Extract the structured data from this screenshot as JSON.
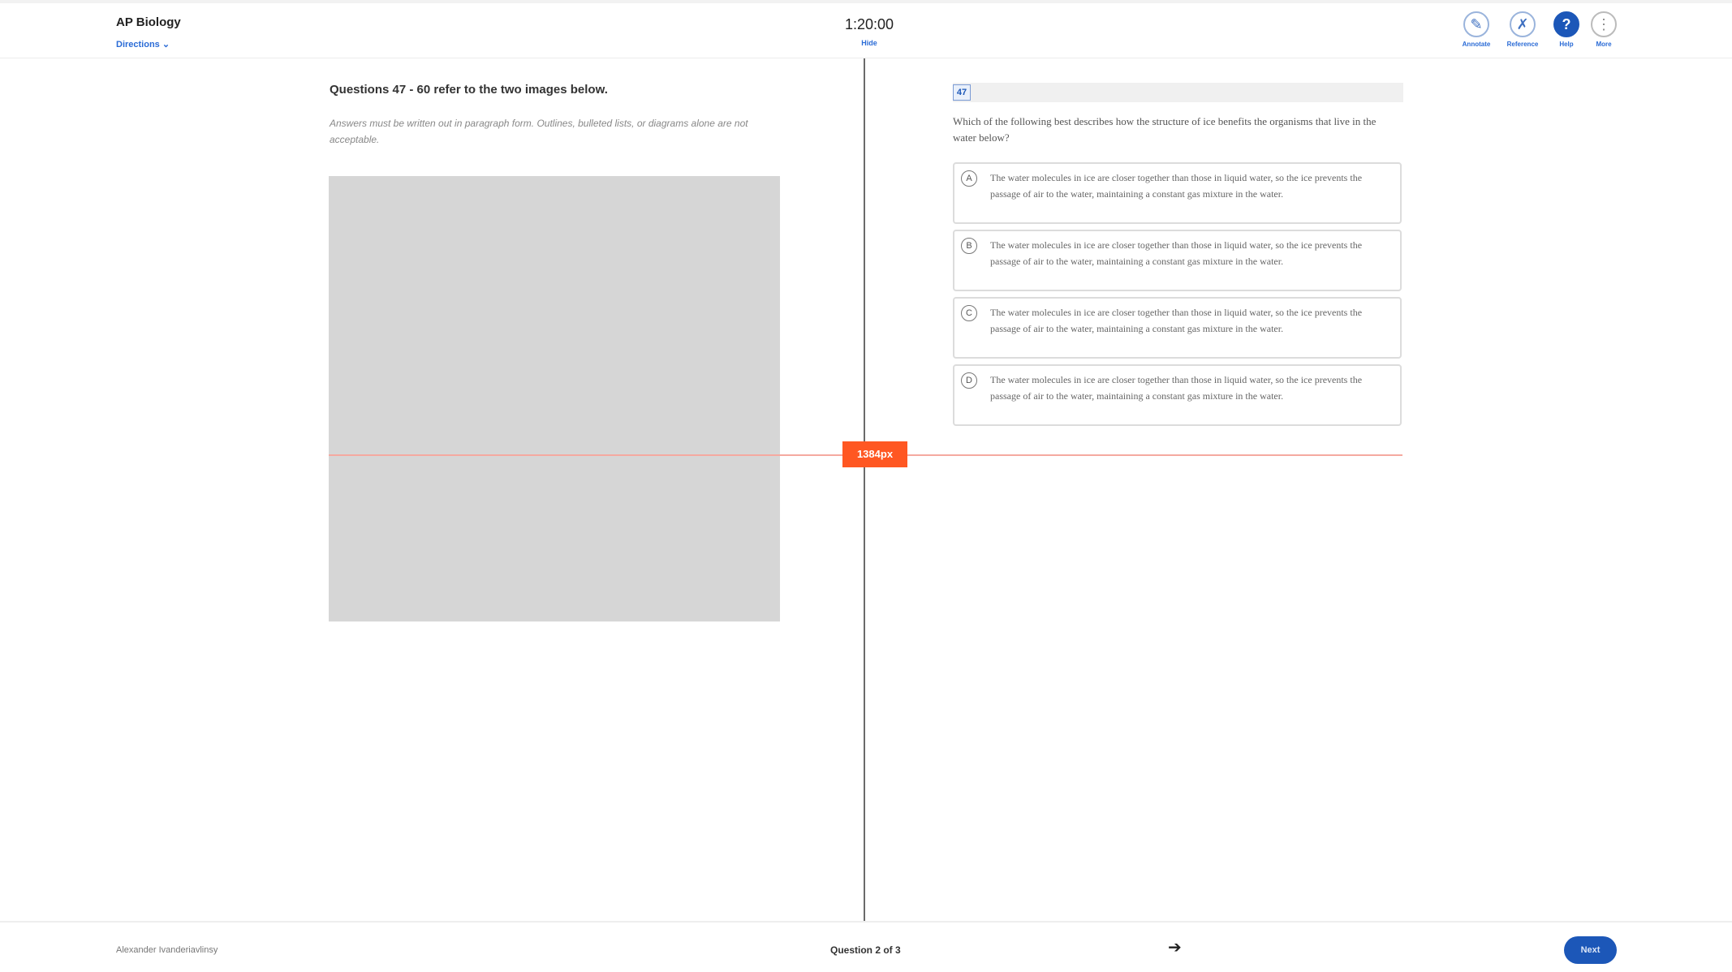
{
  "header": {
    "app_title": "AP Biology",
    "directions_label": "Directions ⌄",
    "timer": "1:20:00",
    "hide_label": "Hide",
    "tools": [
      {
        "label": "Annotate",
        "icon": "pencil-icon",
        "glyph": "✎"
      },
      {
        "label": "Reference",
        "icon": "formula-icon",
        "glyph": "✗"
      },
      {
        "label": "Help",
        "icon": "help-icon",
        "glyph": "?"
      },
      {
        "label": "More",
        "icon": "more-icon",
        "glyph": "⋮"
      }
    ]
  },
  "stimulus": {
    "title": "Questions 47 - 60 refer to the two images below.",
    "note": "Answers must be written out in paragraph form. Outlines, bulleted lists, or diagrams alone are not acceptable."
  },
  "question": {
    "number": "47",
    "stem": "Which of the following best describes how the structure of ice benefits the organisms that live in the water below?",
    "options": [
      {
        "letter": "A",
        "text": "The water molecules in ice are closer together than those in liquid water, so the ice prevents the passage of air to the water, maintaining a constant gas mixture in the water."
      },
      {
        "letter": "B",
        "text": "The water molecules in ice are closer together than those in liquid water, so the ice prevents the passage of air to the water, maintaining a constant gas mixture in the water."
      },
      {
        "letter": "C",
        "text": "The water molecules in ice are closer together than those in liquid water, so the ice prevents the passage of air to the water, maintaining a constant gas mixture in the water."
      },
      {
        "letter": "D",
        "text": "The water molecules in ice are closer together than those in liquid water, so the ice prevents the passage of air to the water, maintaining a constant gas mixture in the water."
      }
    ]
  },
  "ruler": {
    "label": "1384px"
  },
  "footer": {
    "student_name": "Alexander Ivanderiavlinsy",
    "question_nav": "Question 2 of 3",
    "next_label": "Next"
  },
  "colors": {
    "accent": "#1c57b8",
    "ruler": "#ff5722"
  }
}
